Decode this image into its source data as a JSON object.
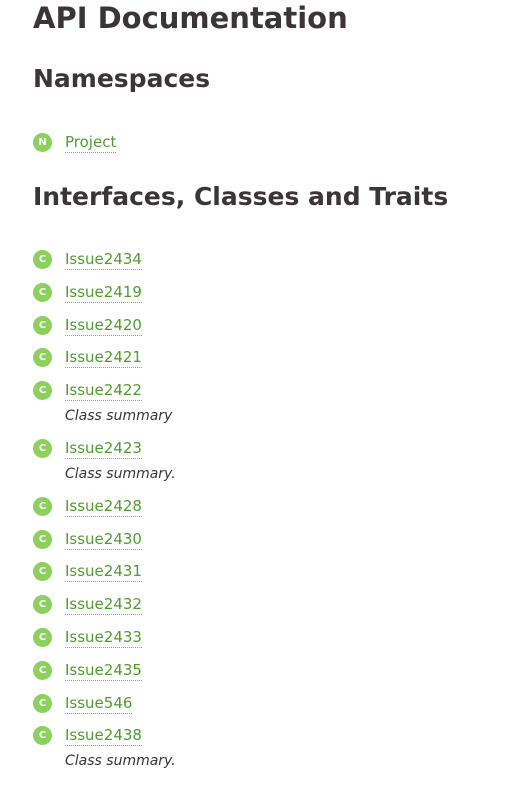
{
  "page": {
    "title": "API Documentation"
  },
  "namespaces": {
    "heading": "Namespaces",
    "items": [
      {
        "badge": "N",
        "name": "Project"
      }
    ]
  },
  "classes": {
    "heading": "Interfaces, Classes and Traits",
    "items": [
      {
        "badge": "C",
        "name": "Issue2434",
        "summary": ""
      },
      {
        "badge": "C",
        "name": "Issue2419",
        "summary": ""
      },
      {
        "badge": "C",
        "name": "Issue2420",
        "summary": ""
      },
      {
        "badge": "C",
        "name": "Issue2421",
        "summary": ""
      },
      {
        "badge": "C",
        "name": "Issue2422",
        "summary": "Class summary"
      },
      {
        "badge": "C",
        "name": "Issue2423",
        "summary": "Class summary."
      },
      {
        "badge": "C",
        "name": "Issue2428",
        "summary": ""
      },
      {
        "badge": "C",
        "name": "Issue2430",
        "summary": ""
      },
      {
        "badge": "C",
        "name": "Issue2431",
        "summary": ""
      },
      {
        "badge": "C",
        "name": "Issue2432",
        "summary": ""
      },
      {
        "badge": "C",
        "name": "Issue2433",
        "summary": ""
      },
      {
        "badge": "C",
        "name": "Issue2435",
        "summary": ""
      },
      {
        "badge": "C",
        "name": "Issue546",
        "summary": ""
      },
      {
        "badge": "C",
        "name": "Issue2438",
        "summary": "Class summary."
      }
    ]
  },
  "colors": {
    "badge": "#8cd15e",
    "link": "#509c2f",
    "text": "#3b3538"
  }
}
